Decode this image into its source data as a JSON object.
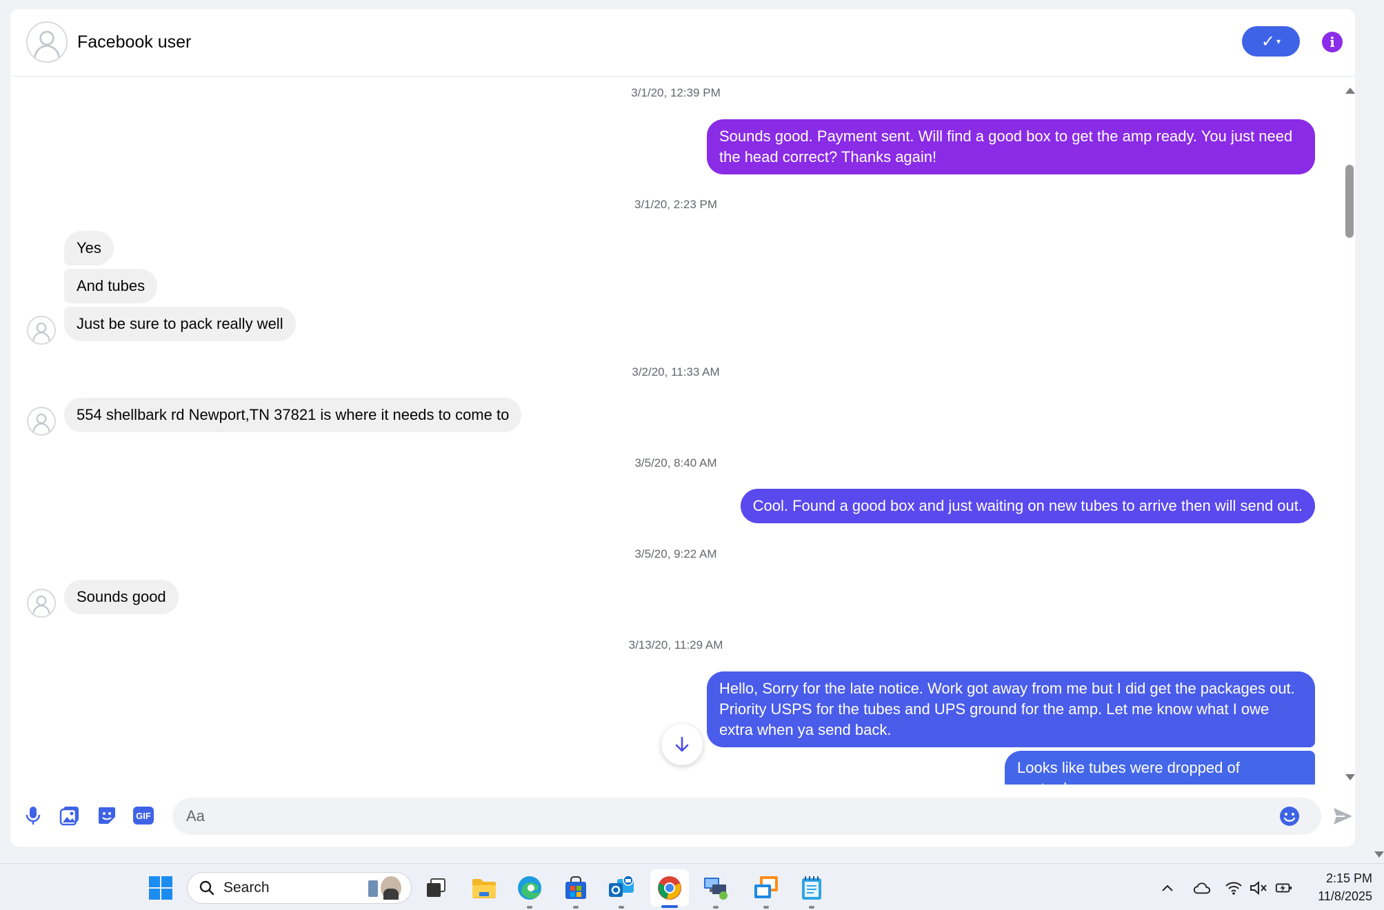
{
  "header": {
    "contact_name": "Facebook user",
    "verify_label": "✓",
    "info_label": "i"
  },
  "messages": {
    "ts1": "3/1/20, 12:39 PM",
    "m1": "Sounds good.  Payment sent.  Will find a good box to get the amp ready.  You just need the head correct?  Thanks again!",
    "ts2": "3/1/20, 2:23 PM",
    "m2": "Yes",
    "m3": "And tubes",
    "m4": "Just be sure to pack really well",
    "ts3": "3/2/20, 11:33 AM",
    "m5": "554 shellbark rd Newport,TN 37821 is where it needs to come to",
    "ts4": "3/5/20, 8:40 AM",
    "m6": "Cool.  Found a good box and just waiting on new tubes to arrive then will send out.",
    "ts5": "3/5/20, 9:22 AM",
    "m7": "Sounds good",
    "ts6": "3/13/20, 11:29 AM",
    "m8": "Hello, Sorry for the late notice.  Work got away from me but I did get the packages out.  Priority USPS for the tubes and UPS ground for the amp.  Let me know what I owe extra when ya send back.",
    "m9": "Looks like tubes were dropped of yesterday -"
  },
  "colors": {
    "outgoing_1": "#8a2be6",
    "outgoing_2": "#5a49ec",
    "outgoing_3": "#4a5cea",
    "outgoing_4": "#4466e9",
    "incoming": "#f0f0f0"
  },
  "composer": {
    "placeholder": "Aa",
    "gif_label": "GIF"
  },
  "taskbar": {
    "search_label": "Search",
    "time": "2:15 PM",
    "date": "11/8/2025"
  }
}
